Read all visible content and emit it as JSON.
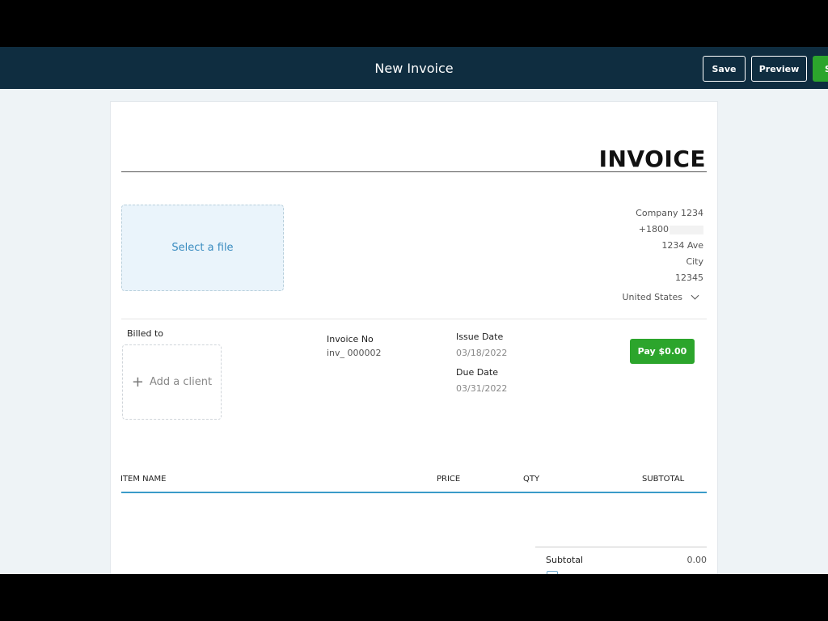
{
  "header": {
    "title": "New Invoice",
    "save_label": "Save",
    "preview_label": "Preview",
    "send_label": "S"
  },
  "invoice": {
    "title": "INVOICE",
    "file_drop_label": "Select a file",
    "company": {
      "name": "Company 1234",
      "phone": "+1800",
      "street": "1234 Ave",
      "city": "City",
      "zip": "12345",
      "country": "United States"
    },
    "billed_to_label": "Billed to",
    "add_client_label": "Add a client",
    "add_client_icon": "plus-icon",
    "invoice_no_label": "Invoice No",
    "invoice_no_value": "inv_  000002",
    "issue_date_label": "Issue Date",
    "issue_date_value": "03/18/2022",
    "due_date_label": "Due Date",
    "due_date_value": "03/31/2022",
    "pay_button_label": "Pay $0.00"
  },
  "table": {
    "headers": [
      "ITEM NAME",
      "PRICE",
      "QTY",
      "SUBTOTAL"
    ]
  },
  "totals": {
    "subtotal_label": "Subtotal",
    "subtotal_value": "0.00"
  },
  "colors": {
    "header_bg": "#0f2d40",
    "accent_green": "#2ca52c",
    "accent_blue": "#3a9bc9"
  }
}
